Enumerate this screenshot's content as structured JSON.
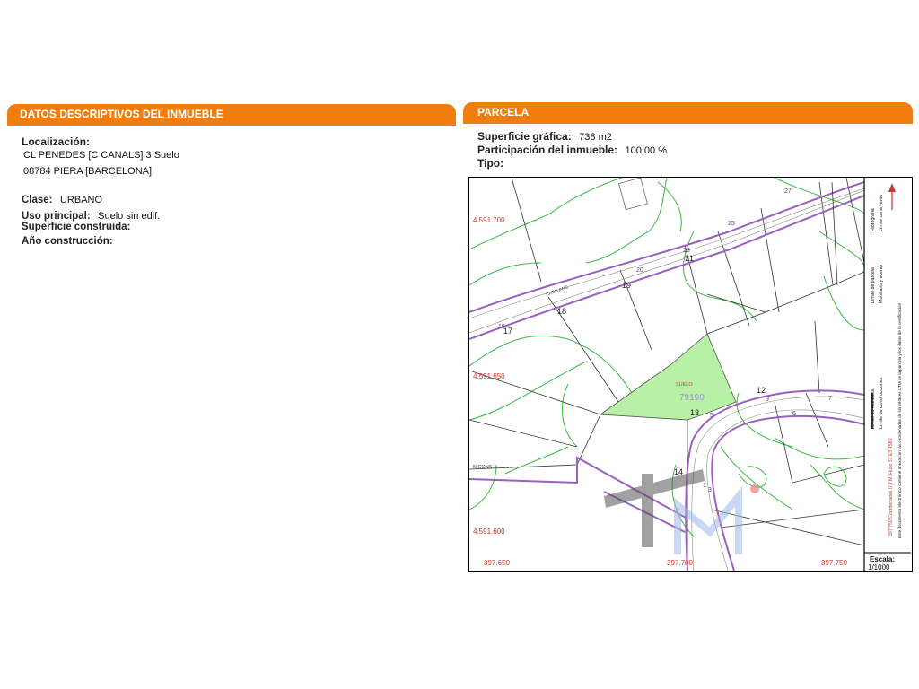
{
  "left_section": {
    "title": "DATOS DESCRIPTIVOS DEL INMUEBLE",
    "localizacion_label": "Localización:",
    "address_line1": "CL PENEDES [C CANALS] 3 Suelo",
    "address_line2": "08784 PIERA [BARCELONA]",
    "clase_label": "Clase:",
    "clase_value": "URBANO",
    "uso_label": "Uso principal:",
    "uso_value": "Suelo sin edif.",
    "superficie_label": "Superficie construida:",
    "ano_label": "Año construcción:"
  },
  "right_section": {
    "title": "PARCELA",
    "superficie_grafica_label": "Superficie gráfica:",
    "superficie_grafica_value": "738 m2",
    "participacion_label": "Participación del inmueble:",
    "participacion_value": "100,00 %",
    "tipo_label": "Tipo:"
  },
  "map": {
    "y_labels": [
      "4.591.700",
      "4.591.650",
      "4.591.600"
    ],
    "x_labels": [
      "397.650",
      "397.700",
      "397.750"
    ],
    "parcel_label": "SUELO",
    "parcel_number": "79190",
    "street_label": "CATALANS",
    "corner_label": "N CONS",
    "plot_numbers": [
      "27",
      "25",
      "23",
      "21",
      "20",
      "19",
      "18",
      "17",
      "15",
      "14",
      "13",
      "12",
      "9",
      "7",
      "6",
      "5",
      "3",
      "1"
    ],
    "scale_label": "Escala:",
    "scale_value": "1/1000",
    "legend": {
      "limite_manzana": "Límite de manzana",
      "limite_parcela": "Límite de parcela",
      "limite_construcciones": "Límite de construcciones",
      "mobiliario_aceras": "Mobiliario y aceras",
      "limite_zona_verde": "Límite zona verde",
      "hidrografia": "Hidrografía",
      "coords_note": "397.750 Coordenadas U.T.M. Huso 31 ETRS89",
      "doc_note": "Este documento electrónico contiene anexo con las coordenadas de los vértices UTM de la parcela y los datos de la certificación"
    }
  },
  "colors": {
    "header": "#f07d10",
    "parcel_fill": "#b8f0a8",
    "contour": "#3cb843",
    "block_limit": "#9b5fc0",
    "coord_text": "#c0392b"
  }
}
